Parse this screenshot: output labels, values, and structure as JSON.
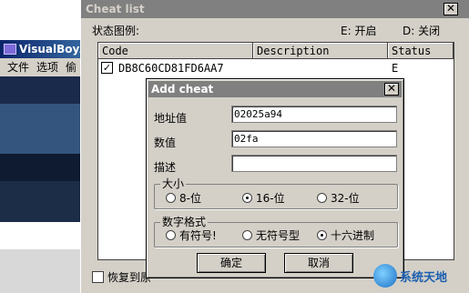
{
  "vba_window": {
    "title": "VisualBoyAd",
    "menu": [
      "文件",
      "选项",
      "偷"
    ]
  },
  "cheat_list": {
    "title": "Cheat list",
    "legend_label": "状态图例:",
    "legend_enabled": "E: 开启",
    "legend_disabled": "D: 关闭",
    "columns": {
      "code": "Code",
      "description": "Description",
      "status": "Status"
    },
    "rows": [
      {
        "checked": true,
        "code": "DB8C60CD81FD6AA7",
        "description": "",
        "status": "E"
      }
    ],
    "restore_label": "恢复到原"
  },
  "add_cheat": {
    "title": "Add cheat",
    "close_glyph": "✕",
    "address_label": "地址值",
    "address_value": "02025a94",
    "value_label": "数值",
    "value_value": "02fa",
    "desc_label": "描述",
    "desc_value": "",
    "size_group": {
      "title": "大小",
      "options": [
        "8-位",
        "16-位",
        "32-位"
      ],
      "selected": "16-位"
    },
    "format_group": {
      "title": "数字格式",
      "options": [
        "有符号!",
        "无符号型",
        "十六进制"
      ],
      "selected": "十六进制"
    },
    "ok_label": "确定",
    "cancel_label": "取消"
  },
  "watermark": {
    "text": "系统天地"
  }
}
